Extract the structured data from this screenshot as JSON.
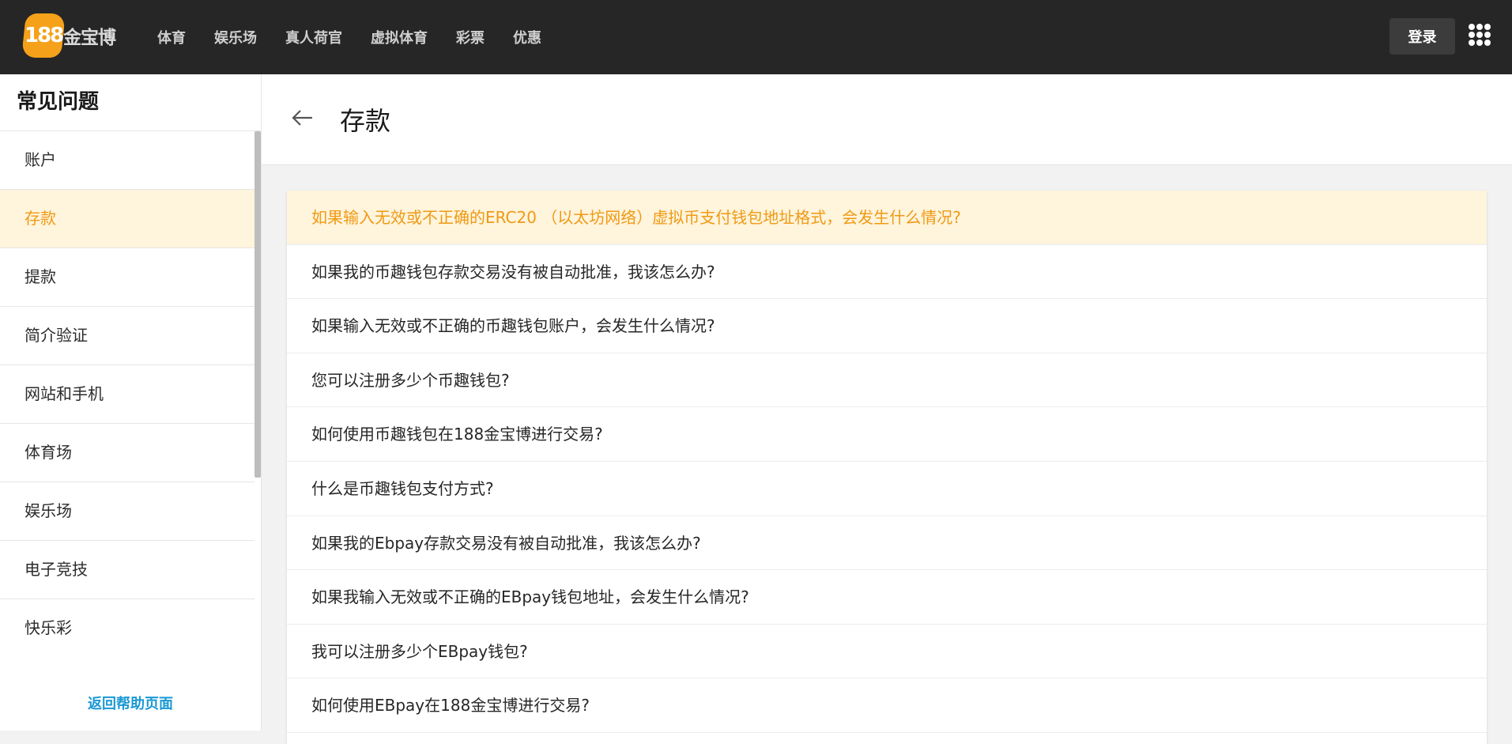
{
  "header": {
    "logo_number": "188",
    "logo_text": "金宝博",
    "nav": [
      "体育",
      "娱乐场",
      "真人荷官",
      "虚拟体育",
      "彩票",
      "优惠"
    ],
    "login_label": "登录",
    "apps_icon": "grid-apps-icon"
  },
  "sidebar": {
    "title": "常见问题",
    "items": [
      {
        "label": "账户",
        "active": false
      },
      {
        "label": "存款",
        "active": true
      },
      {
        "label": "提款",
        "active": false
      },
      {
        "label": "简介验证",
        "active": false
      },
      {
        "label": "网站和手机",
        "active": false
      },
      {
        "label": "体育场",
        "active": false
      },
      {
        "label": "娱乐场",
        "active": false
      },
      {
        "label": "电子竞技",
        "active": false
      },
      {
        "label": "快乐彩",
        "active": false
      }
    ],
    "back_link": "返回帮助页面"
  },
  "main": {
    "back_icon": "arrow-left-icon",
    "title": "存款",
    "faqs": [
      {
        "text": "如果输入无效或不正确的ERC20 （以太坊网络）虚拟币支付钱包地址格式，会发生什么情况?",
        "active": true
      },
      {
        "text": "如果我的币趣钱包存款交易没有被自动批准，我该怎么办?",
        "active": false
      },
      {
        "text": "如果输入无效或不正确的币趣钱包账户，会发生什么情况?",
        "active": false
      },
      {
        "text": "您可以注册多少个币趣钱包?",
        "active": false
      },
      {
        "text": "如何使用币趣钱包在188金宝博进行交易?",
        "active": false
      },
      {
        "text": "什么是币趣钱包支付方式?",
        "active": false
      },
      {
        "text": "如果我的Ebpay存款交易没有被自动批准，我该怎么办?",
        "active": false
      },
      {
        "text": "如果我输入无效或不正确的EBpay钱包地址，会发生什么情况?",
        "active": false
      },
      {
        "text": "我可以注册多少个EBpay钱包?",
        "active": false
      },
      {
        "text": "如何使用EBpay在188金宝博进行交易?",
        "active": false
      }
    ]
  },
  "colors": {
    "accent": "#ef9a14",
    "active_bg": "#fff4dc",
    "link": "#1a98d5",
    "topbar": "#262626"
  }
}
